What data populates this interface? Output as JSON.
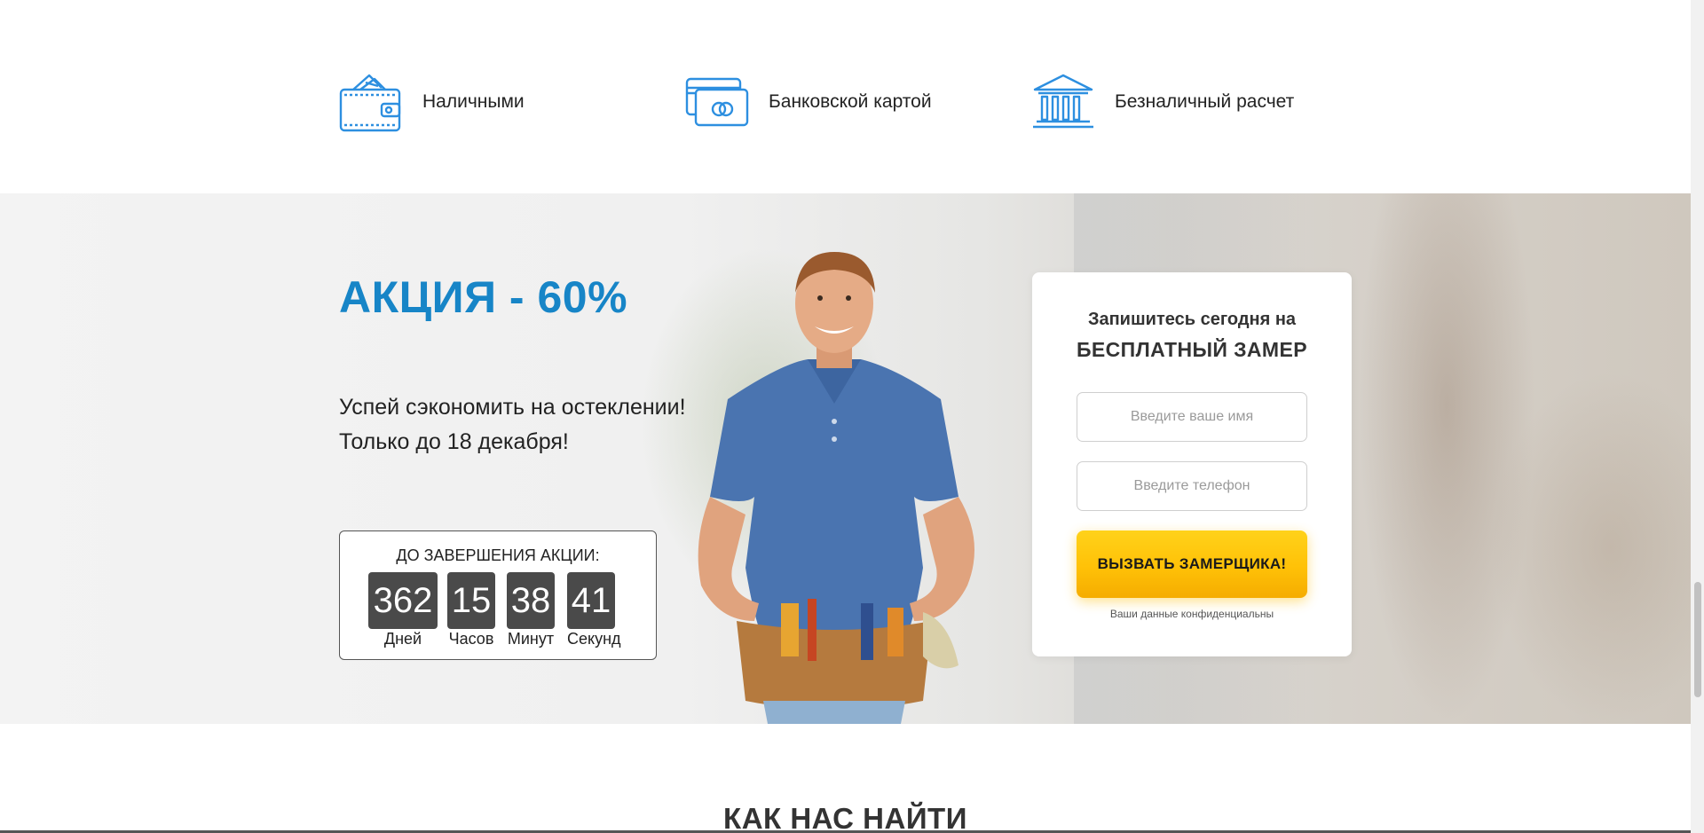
{
  "payments": {
    "items": [
      {
        "label": "Наличными",
        "icon": "wallet-icon"
      },
      {
        "label": "Банковской картой",
        "icon": "credit-card-icon"
      },
      {
        "label": "Безналичный расчет",
        "icon": "bank-icon"
      }
    ]
  },
  "promo": {
    "title": "АКЦИЯ - 60%",
    "subtitle_line1": "Успей сэкономить на остеклении!",
    "subtitle_line2": "Только до 18 декабря!",
    "countdown": {
      "title": "ДО ЗАВЕРШЕНИЯ АКЦИИ:",
      "days": {
        "value": "362",
        "label": "Дней"
      },
      "hours": {
        "value": "15",
        "label": "Часов"
      },
      "minutes": {
        "value": "38",
        "label": "Минут"
      },
      "seconds": {
        "value": "41",
        "label": "Секунд"
      }
    }
  },
  "form": {
    "line1": "Запишитесь сегодня на",
    "line2": "БЕСПЛАТНЫЙ ЗАМЕР",
    "name_placeholder": "Введите ваше имя",
    "phone_placeholder": "Введите телефон",
    "button_label": "ВЫЗВАТЬ ЗАМЕРЩИКА!",
    "note": "Ваши данные конфиденциальны"
  },
  "next_section": {
    "heading": "КАК НАС НАЙТИ"
  },
  "colors": {
    "accent": "#1785c7",
    "icon_blue": "#2d8fe0",
    "button_yellow": "#ffc107",
    "countdown_bg": "#4a4a4a"
  }
}
